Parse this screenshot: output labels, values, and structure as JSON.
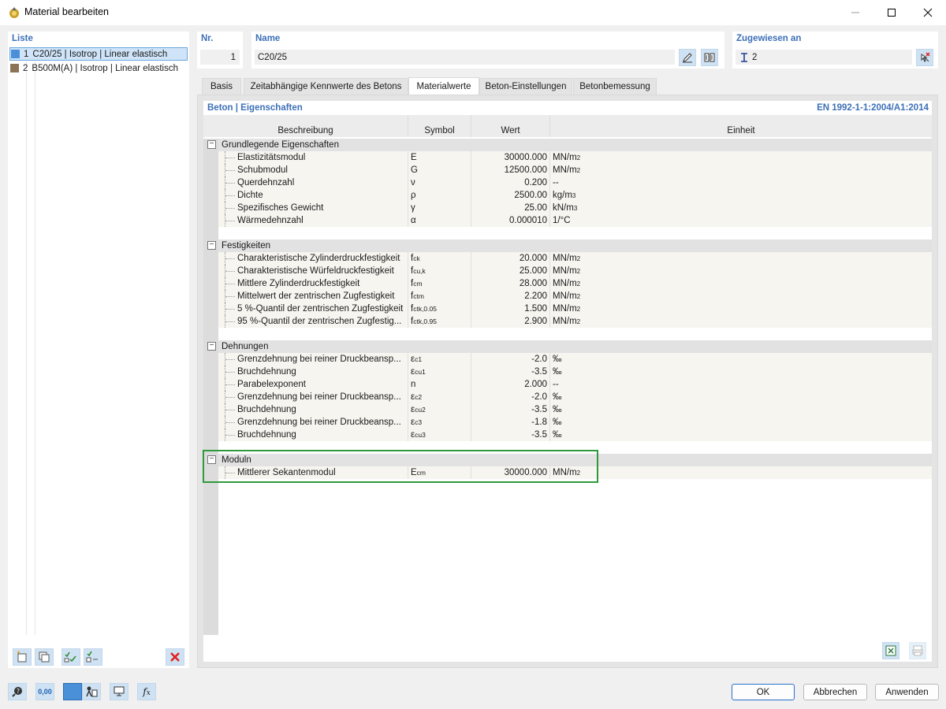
{
  "window": {
    "title": "Material bearbeiten"
  },
  "list": {
    "label": "Liste",
    "items": [
      {
        "nr": "1",
        "text": "C20/25 | Isotrop | Linear elastisch",
        "color": "#4a90d9"
      },
      {
        "nr": "2",
        "text": "B500M(A) | Isotrop | Linear elastisch",
        "color": "#8b7355"
      }
    ]
  },
  "header": {
    "nr_label": "Nr.",
    "nr_value": "1",
    "name_label": "Name",
    "name_value": "C20/25",
    "assigned_label": "Zugewiesen an",
    "assigned_value": "2"
  },
  "tabs": [
    {
      "label": "Basis",
      "active": false
    },
    {
      "label": "Zeitabhängige Kennwerte des Betons",
      "active": false
    },
    {
      "label": "Materialwerte",
      "active": true
    },
    {
      "label": "Beton-Einstellungen",
      "active": false
    },
    {
      "label": "Betonbemessung",
      "active": false
    }
  ],
  "section": {
    "title": "Beton | Eigenschaften",
    "norm": "EN 1992-1-1:2004/A1:2014"
  },
  "table": {
    "columns": {
      "desc": "Beschreibung",
      "sym": "Symbol",
      "val": "Wert",
      "unit": "Einheit"
    },
    "groups": [
      {
        "title": "Grundlegende Eigenschaften",
        "rows": [
          {
            "desc": "Elastizitätsmodul",
            "sym": "E",
            "sub": "",
            "val": "30000.000",
            "unit": "MN/m",
            "sup": "2"
          },
          {
            "desc": "Schubmodul",
            "sym": "G",
            "sub": "",
            "val": "12500.000",
            "unit": "MN/m",
            "sup": "2"
          },
          {
            "desc": "Querdehnzahl",
            "sym": "ν",
            "sub": "",
            "val": "0.200",
            "unit": "--",
            "sup": ""
          },
          {
            "desc": "Dichte",
            "sym": "ρ",
            "sub": "",
            "val": "2500.00",
            "unit": "kg/m",
            "sup": "3"
          },
          {
            "desc": "Spezifisches Gewicht",
            "sym": "γ",
            "sub": "",
            "val": "25.00",
            "unit": "kN/m",
            "sup": "3"
          },
          {
            "desc": "Wärmedehnzahl",
            "sym": "α",
            "sub": "",
            "val": "0.000010",
            "unit": "1/°C",
            "sup": ""
          }
        ]
      },
      {
        "title": "Festigkeiten",
        "rows": [
          {
            "desc": "Charakteristische Zylinderdruckfestigkeit",
            "sym": "f",
            "sub": "ck",
            "val": "20.000",
            "unit": "MN/m",
            "sup": "2"
          },
          {
            "desc": "Charakteristische Würfeldruckfestigkeit",
            "sym": "f",
            "sub": "cu,k",
            "val": "25.000",
            "unit": "MN/m",
            "sup": "2"
          },
          {
            "desc": "Mittlere Zylinderdruckfestigkeit",
            "sym": "f",
            "sub": "cm",
            "val": "28.000",
            "unit": "MN/m",
            "sup": "2"
          },
          {
            "desc": "Mittelwert der zentrischen Zugfestigkeit",
            "sym": "f",
            "sub": "ctm",
            "val": "2.200",
            "unit": "MN/m",
            "sup": "2"
          },
          {
            "desc": "5 %-Quantil der zentrischen Zugfestigkeit",
            "sym": "f",
            "sub": "ctk,0.05",
            "val": "1.500",
            "unit": "MN/m",
            "sup": "2"
          },
          {
            "desc": "95 %-Quantil der zentrischen Zugfestig...",
            "sym": "f",
            "sub": "ctk,0.95",
            "val": "2.900",
            "unit": "MN/m",
            "sup": "2"
          }
        ]
      },
      {
        "title": "Dehnungen",
        "rows": [
          {
            "desc": "Grenzdehnung bei reiner Druckbeansp...",
            "sym": "ε",
            "sub": "c1",
            "val": "-2.0",
            "unit": "‰",
            "sup": ""
          },
          {
            "desc": "Bruchdehnung",
            "sym": "ε",
            "sub": "cu1",
            "val": "-3.5",
            "unit": "‰",
            "sup": ""
          },
          {
            "desc": "Parabelexponent",
            "sym": "n",
            "sub": "",
            "val": "2.000",
            "unit": "--",
            "sup": ""
          },
          {
            "desc": "Grenzdehnung bei reiner Druckbeansp...",
            "sym": "ε",
            "sub": "c2",
            "val": "-2.0",
            "unit": "‰",
            "sup": ""
          },
          {
            "desc": "Bruchdehnung",
            "sym": "ε",
            "sub": "cu2",
            "val": "-3.5",
            "unit": "‰",
            "sup": ""
          },
          {
            "desc": "Grenzdehnung bei reiner Druckbeansp...",
            "sym": "ε",
            "sub": "c3",
            "val": "-1.8",
            "unit": "‰",
            "sup": ""
          },
          {
            "desc": "Bruchdehnung",
            "sym": "ε",
            "sub": "cu3",
            "val": "-3.5",
            "unit": "‰",
            "sup": ""
          }
        ]
      },
      {
        "title": "Moduln",
        "rows": [
          {
            "desc": "Mittlerer Sekantenmodul",
            "sym": "E",
            "sub": "cm",
            "val": "30000.000",
            "unit": "MN/m",
            "sup": "2"
          }
        ]
      }
    ]
  },
  "footer": {
    "ok": "OK",
    "cancel": "Abbrechen",
    "apply": "Anwenden",
    "units_btn": "0,00"
  },
  "colors": {
    "accent": "#3d70b8",
    "highlight": "#2e9a3b",
    "delete": "#e02020"
  }
}
